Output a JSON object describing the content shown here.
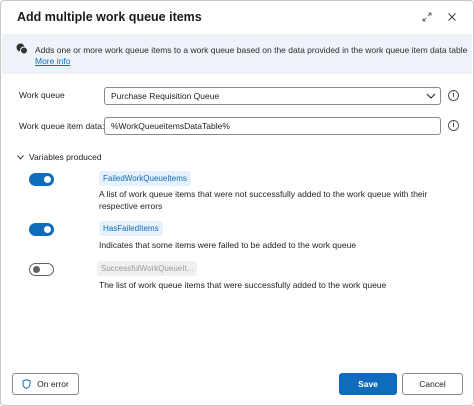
{
  "dialog": {
    "title": "Add multiple work queue items",
    "expand_icon": "expand-arrows-icon",
    "close_icon": "close-icon"
  },
  "info_bar": {
    "icon": "info-bubble-icon",
    "text": "Adds one or more work queue items to a work queue based on the data provided in the work queue item data table",
    "link": "More info"
  },
  "fields": {
    "work_queue": {
      "label": "Work queue",
      "value": "Purchase Requisition Queue"
    },
    "work_queue_item_data": {
      "label": "Work queue item data:",
      "value": "%WorkQueueitemsDataTable%"
    }
  },
  "variables": {
    "section_title": "Variables produced",
    "expanded": true,
    "items": [
      {
        "name": "FailedWorkQueueItems",
        "enabled": true,
        "description": "A list of work queue items that were not successfully added to the work queue with their respective errors"
      },
      {
        "name": "HasFailedItems",
        "enabled": true,
        "description": "Indicates that some items were failed to be added to the work queue"
      },
      {
        "name": "SuccessfulWorkQueueIt...",
        "enabled": false,
        "description": "The list of work queue items that were successfully added to the work queue"
      }
    ]
  },
  "footer": {
    "on_error_label": "On error",
    "save_label": "Save",
    "cancel_label": "Cancel"
  },
  "colors": {
    "accent": "#0f6cbd",
    "info_background": "#eef3fa"
  }
}
